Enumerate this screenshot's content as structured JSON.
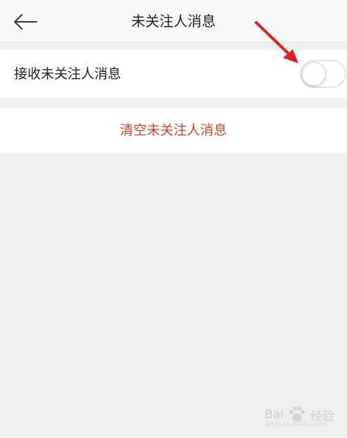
{
  "header": {
    "title": "未关注人消息",
    "back_icon": "arrow-left-icon"
  },
  "toggle_row": {
    "label": "接收未关注人消息",
    "switch_on": false
  },
  "clear_row": {
    "label": "清空未关注人消息",
    "color": "#d9432a"
  },
  "annotation": {
    "arrow_color": "#e02020"
  },
  "watermark": {
    "brand": "Bai",
    "suffix": "经验",
    "url": "jingyan.baidu.com"
  },
  "colors": {
    "background": "#efefef",
    "card": "#ffffff",
    "header": "#f7f7f7",
    "accent_red": "#d9432a"
  }
}
